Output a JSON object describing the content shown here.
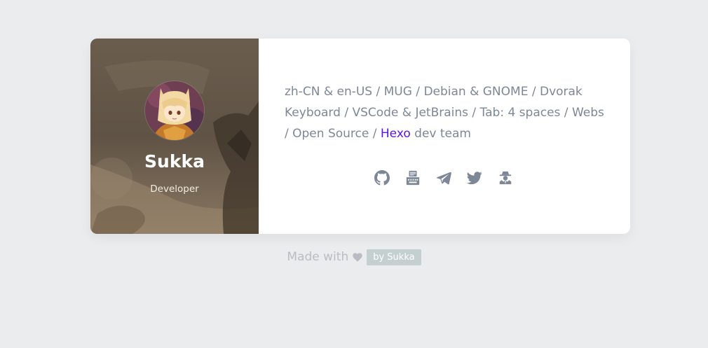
{
  "profile": {
    "name": "Sukka",
    "role": "Developer"
  },
  "bio": {
    "text_before_link": "zh-CN & en-US / MUG / Debian & GNOME / Dvorak Keyboard / VSCode & JetBrains / Tab: 4 spaces / Webs / Open Source / ",
    "link_label": "Hexo",
    "text_after_link": " dev team"
  },
  "socials": [
    {
      "icon": "github-icon"
    },
    {
      "icon": "typewriter-icon"
    },
    {
      "icon": "telegram-icon"
    },
    {
      "icon": "twitter-icon"
    },
    {
      "icon": "spy-icon"
    }
  ],
  "footer": {
    "made_with": "Made with",
    "badge": "by Sukka"
  },
  "colors": {
    "page_bg": "#ebecee",
    "text_muted": "#7e8795",
    "link": "#5b13df",
    "footer_text": "#b9bdc3",
    "badge_bg": "#c4cfcf"
  }
}
